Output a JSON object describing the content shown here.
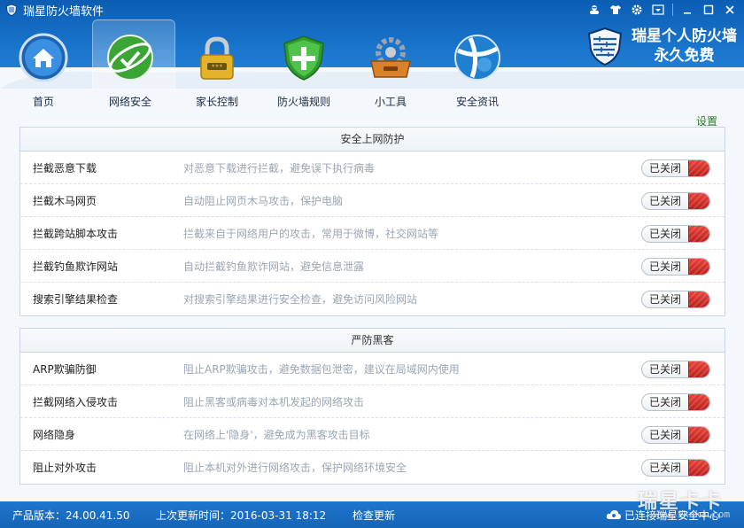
{
  "app": {
    "title": "瑞星防火墙软件"
  },
  "brand": {
    "line1": "瑞星个人防火墙",
    "line2": "永久免费"
  },
  "window_controls": [
    "skin-person-icon",
    "tshirt-icon",
    "gear-icon",
    "menu-icon",
    "minimize-icon",
    "maximize-icon",
    "close-icon"
  ],
  "nav": [
    {
      "label": "首页",
      "icon": "home-icon",
      "active": false
    },
    {
      "label": "网络安全",
      "icon": "network-security-icon",
      "active": true
    },
    {
      "label": "家长控制",
      "icon": "lock-icon",
      "active": false
    },
    {
      "label": "防火墙规则",
      "icon": "shield-icon",
      "active": false
    },
    {
      "label": "小工具",
      "icon": "toolbox-icon",
      "active": false
    },
    {
      "label": "安全资讯",
      "icon": "globe-icon",
      "active": false
    }
  ],
  "settings_link": "设置",
  "sections": [
    {
      "title": "安全上网防护",
      "rows": [
        {
          "name": "拦截恶意下载",
          "desc": "对恶意下载进行拦截，避免误下执行病毒",
          "state": "已关闭"
        },
        {
          "name": "拦截木马网页",
          "desc": "自动阻止网页木马攻击，保护电脑",
          "state": "已关闭"
        },
        {
          "name": "拦截跨站脚本攻击",
          "desc": "拦截来自于网络用户的攻击，常用于微博，社交网站等",
          "state": "已关闭"
        },
        {
          "name": "拦截钓鱼欺诈网站",
          "desc": "自动拦截钓鱼欺诈网站，避免信息泄露",
          "state": "已关闭"
        },
        {
          "name": "搜索引擎结果检查",
          "desc": "对搜索引擎结果进行安全检查，避免访问风险网站",
          "state": "已关闭"
        }
      ]
    },
    {
      "title": "严防黑客",
      "rows": [
        {
          "name": "ARP欺骗防御",
          "desc": "阻止ARP欺骗攻击，避免数据包泄密，建议在局域网内使用",
          "state": "已关闭"
        },
        {
          "name": "拦截网络入侵攻击",
          "desc": "阻止黑客或病毒对本机发起的网络攻击",
          "state": "已关闭"
        },
        {
          "name": "网络隐身",
          "desc": "在网络上'隐身'，避免成为黑客攻击目标",
          "state": "已关闭"
        },
        {
          "name": "阻止对外攻击",
          "desc": "阻止本机对外进行网络攻击，保护网络环境安全",
          "state": "已关闭"
        }
      ]
    }
  ],
  "status": {
    "version": "产品版本：24.00.41.50",
    "last_update": "上次更新时间：2016-03-31 18:12",
    "check_update": "检查更新",
    "cloud_status": "已连接瑞星安全中心"
  },
  "watermark": {
    "big": "瑞星卡卡",
    "small": "www.ikaka.com"
  },
  "colors": {
    "header_blue": "#1a75cc",
    "toggle_off_red": "#d13028",
    "settings_green": "#2c7a2c"
  }
}
